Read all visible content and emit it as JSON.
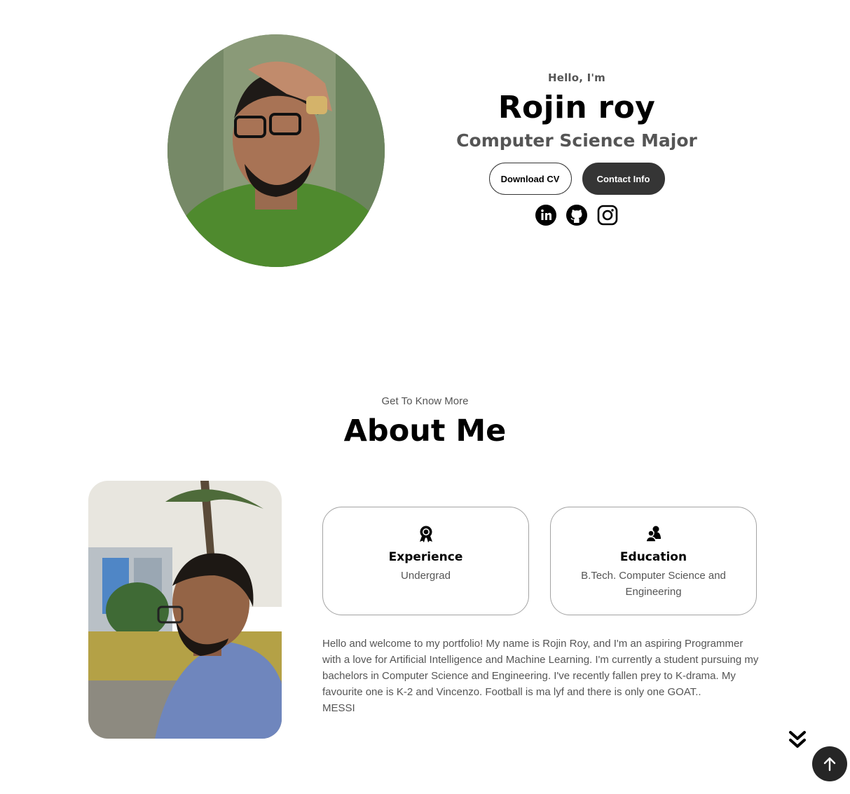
{
  "hero": {
    "greeting": "Hello, I'm",
    "name": "Rojin roy",
    "role": "Computer Science Major",
    "buttons": {
      "download_cv": "Download CV",
      "contact_info": "Contact Info"
    },
    "socials": [
      "linkedin-icon",
      "github-icon",
      "instagram-icon"
    ]
  },
  "about": {
    "subtitle": "Get To Know More",
    "title": "About Me",
    "cards": [
      {
        "icon": "award-icon",
        "title": "Experience",
        "text": "Undergrad"
      },
      {
        "icon": "users-icon",
        "title": "Education",
        "text": "B.Tech. Computer Science and Engineering"
      }
    ],
    "bio": "Hello and welcome to my portfolio! My name is Rojin Roy, and I'm an aspiring Programmer with a love for Artificial Intelligence and Machine Learning. I'm currently a student pursuing my bachelors in Computer Science and Engineering. I've recently fallen prey to K-drama. My favourite one is K-2 and Vincenzo. Football is ma lyf and there is only one GOAT..",
    "bio_tail": "MESSI"
  },
  "colors": {
    "accent_dark": "#353535",
    "text_muted": "#555555",
    "card_border": "#a3a3a3"
  }
}
